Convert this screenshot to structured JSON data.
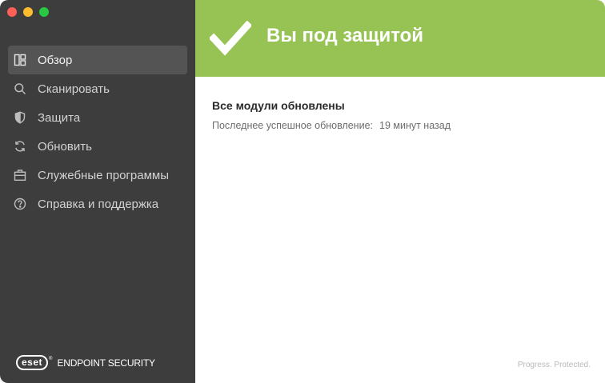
{
  "sidebar": {
    "items": [
      {
        "label": "Обзор",
        "icon": "overview-icon",
        "active": true
      },
      {
        "label": "Сканировать",
        "icon": "search-icon",
        "active": false
      },
      {
        "label": "Защита",
        "icon": "shield-icon",
        "active": false
      },
      {
        "label": "Обновить",
        "icon": "refresh-icon",
        "active": false
      },
      {
        "label": "Служебные программы",
        "icon": "briefcase-icon",
        "active": false
      },
      {
        "label": "Справка и поддержка",
        "icon": "help-icon",
        "active": false
      }
    ],
    "brand": {
      "logo_text": "eset",
      "trademark": "®",
      "product": "ENDPOINT SECURITY"
    }
  },
  "banner": {
    "title": "Вы под защитой",
    "color": "#97c355",
    "icon": "checkmark-icon"
  },
  "status": {
    "heading": "Все модули обновлены",
    "last_update_label": "Последнее успешное обновление:",
    "last_update_value": "19 минут назад"
  },
  "footer": {
    "tagline": "Progress. Protected."
  },
  "colors": {
    "sidebar_bg": "#3d3d3d",
    "sidebar_active": "#545454",
    "accent_green": "#97c355"
  }
}
